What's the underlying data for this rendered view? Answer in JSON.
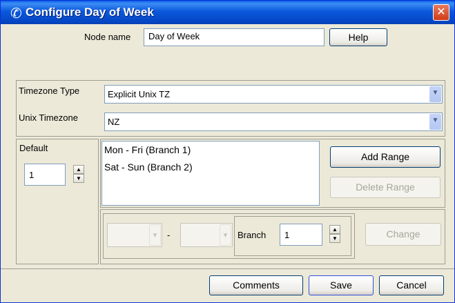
{
  "window": {
    "title": "Configure Day of Week",
    "close_glyph": "✕",
    "icon": "phone-handset-icon"
  },
  "node": {
    "label": "Node name",
    "value": "Day of Week",
    "help_label": "Help"
  },
  "timezone": {
    "type_label": "Timezone Type",
    "type_value": "Explicit Unix TZ",
    "unix_label": "Unix Timezone",
    "unix_value": "NZ"
  },
  "default": {
    "label": "Default",
    "value": "1"
  },
  "ranges": {
    "items": [
      "Mon - Fri (Branch 1)",
      "Sat - Sun (Branch 2)"
    ]
  },
  "range_actions": {
    "add_label": "Add Range",
    "delete_label": "Delete Range"
  },
  "editor": {
    "from_value": "",
    "dash": "-",
    "to_value": "",
    "branch_label": "Branch",
    "branch_value": "1",
    "change_label": "Change"
  },
  "footer": {
    "comments_label": "Comments",
    "save_label": "Save",
    "cancel_label": "Cancel"
  },
  "colors": {
    "titlebar": "#0a5fe8",
    "window_bg": "#ece9d8",
    "close": "#d23b16"
  }
}
